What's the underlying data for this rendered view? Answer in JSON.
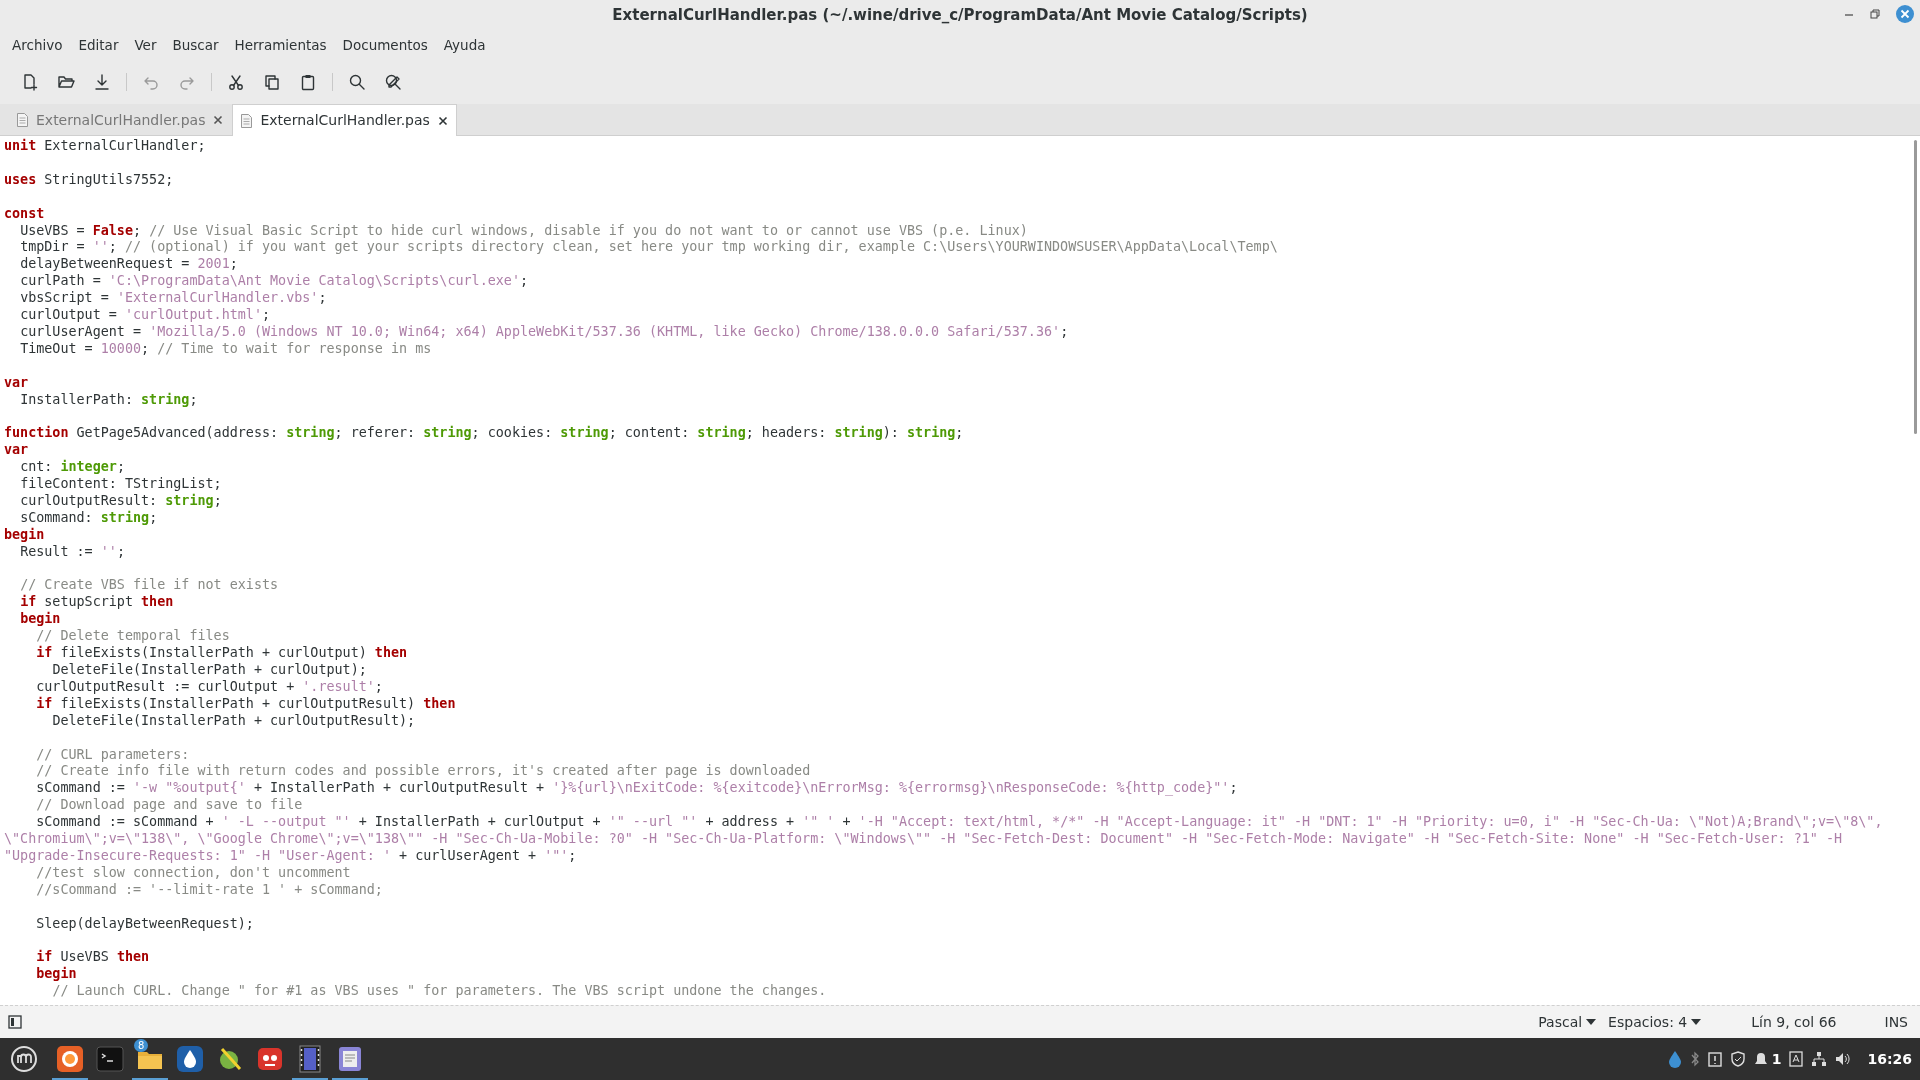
{
  "window": {
    "title": "ExternalCurlHandler.pas (~/.wine/drive_c/ProgramData/Ant Movie Catalog/Scripts)"
  },
  "menu": [
    "Archivo",
    "Editar",
    "Ver",
    "Buscar",
    "Herramientas",
    "Documentos",
    "Ayuda"
  ],
  "toolbar": [
    {
      "disabled": false
    },
    {
      "disabled": false
    },
    {
      "disabled": false
    },
    {
      "disabled": true
    },
    {
      "disabled": true
    },
    {
      "disabled": false
    },
    {
      "disabled": false
    },
    {
      "disabled": false
    },
    {
      "disabled": false
    },
    {
      "disabled": false
    }
  ],
  "tabs": [
    {
      "label": "ExternalCurlHandler.pas",
      "selected": false
    },
    {
      "label": "ExternalCurlHandler.pas",
      "selected": true
    }
  ],
  "editor": {
    "lines": [
      {
        "kind": "code",
        "tokens": [
          {
            "kind": "keyword",
            "text": "unit"
          },
          {
            "kind": "plain",
            "text": " ExternalCurlHandler;"
          }
        ]
      },
      {
        "kind": "blank"
      },
      {
        "kind": "code",
        "tokens": [
          {
            "kind": "keyword",
            "text": "uses"
          },
          {
            "kind": "plain",
            "text": " StringUtils7552;"
          }
        ]
      },
      {
        "kind": "blank"
      },
      {
        "kind": "code",
        "tokens": [
          {
            "kind": "keyword",
            "text": "const"
          }
        ]
      },
      {
        "kind": "code",
        "tokens": [
          {
            "kind": "plain",
            "text": "  UseVBS = "
          },
          {
            "kind": "keyword",
            "text": "False"
          },
          {
            "kind": "plain",
            "text": "; "
          },
          {
            "kind": "comment",
            "text": "// Use Visual Basic Script to hide curl windows, disable if you do not want to or cannot use VBS (p.e. Linux)"
          }
        ]
      },
      {
        "kind": "code",
        "tokens": [
          {
            "kind": "plain",
            "text": "  tmpDir = "
          },
          {
            "kind": "string",
            "text": "''"
          },
          {
            "kind": "plain",
            "text": "; "
          },
          {
            "kind": "comment",
            "text": "// (optional) if you want get your scripts directory clean, set here your tmp working dir, example C:\\Users\\YOURWINDOWSUSER\\AppData\\Local\\Temp\\"
          }
        ]
      },
      {
        "kind": "code",
        "tokens": [
          {
            "kind": "plain",
            "text": "  delayBetweenRequest = "
          },
          {
            "kind": "number",
            "text": "2001"
          },
          {
            "kind": "plain",
            "text": ";"
          }
        ]
      },
      {
        "kind": "code",
        "tokens": [
          {
            "kind": "plain",
            "text": "  curlPath = "
          },
          {
            "kind": "string",
            "text": "'C:\\ProgramData\\Ant Movie Catalog\\Scripts\\curl.exe'"
          },
          {
            "kind": "plain",
            "text": ";"
          }
        ]
      },
      {
        "kind": "code",
        "tokens": [
          {
            "kind": "plain",
            "text": "  vbsScript = "
          },
          {
            "kind": "string",
            "text": "'ExternalCurlHandler.vbs'"
          },
          {
            "kind": "plain",
            "text": ";"
          }
        ]
      },
      {
        "kind": "code",
        "tokens": [
          {
            "kind": "plain",
            "text": "  curlOutput = "
          },
          {
            "kind": "string",
            "text": "'curlOutput.html'"
          },
          {
            "kind": "plain",
            "text": ";"
          }
        ]
      },
      {
        "kind": "code",
        "tokens": [
          {
            "kind": "plain",
            "text": "  curlUserAgent = "
          },
          {
            "kind": "string",
            "text": "'Mozilla/5.0 (Windows NT 10.0; Win64; x64) AppleWebKit/537.36 (KHTML, like Gecko) Chrome/138.0.0.0 Safari/537.36'"
          },
          {
            "kind": "plain",
            "text": ";"
          }
        ]
      },
      {
        "kind": "code",
        "tokens": [
          {
            "kind": "plain",
            "text": "  TimeOut = "
          },
          {
            "kind": "number",
            "text": "10000"
          },
          {
            "kind": "plain",
            "text": "; "
          },
          {
            "kind": "comment",
            "text": "// Time to wait for response in ms"
          }
        ]
      },
      {
        "kind": "blank"
      },
      {
        "kind": "code",
        "tokens": [
          {
            "kind": "keyword",
            "text": "var"
          }
        ]
      },
      {
        "kind": "code",
        "tokens": [
          {
            "kind": "plain",
            "text": "  InstallerPath: "
          },
          {
            "kind": "type",
            "text": "string"
          },
          {
            "kind": "plain",
            "text": ";"
          }
        ]
      },
      {
        "kind": "blank"
      },
      {
        "kind": "code",
        "tokens": [
          {
            "kind": "keyword",
            "text": "function"
          },
          {
            "kind": "plain",
            "text": " GetPage5Advanced(address: "
          },
          {
            "kind": "type",
            "text": "string"
          },
          {
            "kind": "plain",
            "text": "; referer: "
          },
          {
            "kind": "type",
            "text": "string"
          },
          {
            "kind": "plain",
            "text": "; cookies: "
          },
          {
            "kind": "type",
            "text": "string"
          },
          {
            "kind": "plain",
            "text": "; content: "
          },
          {
            "kind": "type",
            "text": "string"
          },
          {
            "kind": "plain",
            "text": "; headers: "
          },
          {
            "kind": "type",
            "text": "string"
          },
          {
            "kind": "plain",
            "text": "): "
          },
          {
            "kind": "type",
            "text": "string"
          },
          {
            "kind": "plain",
            "text": ";"
          }
        ]
      },
      {
        "kind": "code",
        "tokens": [
          {
            "kind": "keyword",
            "text": "var"
          }
        ]
      },
      {
        "kind": "code",
        "tokens": [
          {
            "kind": "plain",
            "text": "  cnt: "
          },
          {
            "kind": "type",
            "text": "integer"
          },
          {
            "kind": "plain",
            "text": ";"
          }
        ]
      },
      {
        "kind": "code",
        "tokens": [
          {
            "kind": "plain",
            "text": "  fileContent: TStringList;"
          }
        ]
      },
      {
        "kind": "code",
        "tokens": [
          {
            "kind": "plain",
            "text": "  curlOutputResult: "
          },
          {
            "kind": "type",
            "text": "string"
          },
          {
            "kind": "plain",
            "text": ";"
          }
        ]
      },
      {
        "kind": "code",
        "tokens": [
          {
            "kind": "plain",
            "text": "  sCommand: "
          },
          {
            "kind": "type",
            "text": "string"
          },
          {
            "kind": "plain",
            "text": ";"
          }
        ]
      },
      {
        "kind": "code",
        "tokens": [
          {
            "kind": "keyword",
            "text": "begin"
          }
        ]
      },
      {
        "kind": "code",
        "tokens": [
          {
            "kind": "plain",
            "text": "  Result := "
          },
          {
            "kind": "string",
            "text": "''"
          },
          {
            "kind": "plain",
            "text": ";"
          }
        ]
      },
      {
        "kind": "blank"
      },
      {
        "kind": "code",
        "tokens": [
          {
            "kind": "comment",
            "text": "  // Create VBS file if not exists"
          }
        ]
      },
      {
        "kind": "code",
        "tokens": [
          {
            "kind": "keyword",
            "text": "  if"
          },
          {
            "kind": "plain",
            "text": " setupScript "
          },
          {
            "kind": "keyword",
            "text": "then"
          }
        ]
      },
      {
        "kind": "code",
        "tokens": [
          {
            "kind": "keyword",
            "text": "  begin"
          }
        ]
      },
      {
        "kind": "code",
        "tokens": [
          {
            "kind": "comment",
            "text": "    // Delete temporal files"
          }
        ]
      },
      {
        "kind": "code",
        "tokens": [
          {
            "kind": "keyword",
            "text": "    if"
          },
          {
            "kind": "plain",
            "text": " fileExists(InstallerPath + curlOutput) "
          },
          {
            "kind": "keyword",
            "text": "then"
          }
        ]
      },
      {
        "kind": "code",
        "tokens": [
          {
            "kind": "plain",
            "text": "      DeleteFile(InstallerPath + curlOutput);"
          }
        ]
      },
      {
        "kind": "code",
        "tokens": [
          {
            "kind": "plain",
            "text": "    curlOutputResult := curlOutput + "
          },
          {
            "kind": "string",
            "text": "'.result'"
          },
          {
            "kind": "plain",
            "text": ";"
          }
        ]
      },
      {
        "kind": "code",
        "tokens": [
          {
            "kind": "keyword",
            "text": "    if"
          },
          {
            "kind": "plain",
            "text": " fileExists(InstallerPath + curlOutputResult) "
          },
          {
            "kind": "keyword",
            "text": "then"
          }
        ]
      },
      {
        "kind": "code",
        "tokens": [
          {
            "kind": "plain",
            "text": "      DeleteFile(InstallerPath + curlOutputResult);"
          }
        ]
      },
      {
        "kind": "blank"
      },
      {
        "kind": "code",
        "tokens": [
          {
            "kind": "comment",
            "text": "    // CURL parameters:"
          }
        ]
      },
      {
        "kind": "code",
        "tokens": [
          {
            "kind": "comment",
            "text": "    // Create info file with return codes and possible errors, it's created after page is downloaded"
          }
        ]
      },
      {
        "kind": "code",
        "tokens": [
          {
            "kind": "plain",
            "text": "    sCommand := "
          },
          {
            "kind": "string",
            "text": "'-w \"%output{'"
          },
          {
            "kind": "plain",
            "text": " + InstallerPath + curlOutputResult + "
          },
          {
            "kind": "string",
            "text": "'}%{url}\\nExitCode: %{exitcode}\\nErrorMsg: %{errormsg}\\nResponseCode: %{http_code}\"'"
          },
          {
            "kind": "plain",
            "text": ";"
          }
        ]
      },
      {
        "kind": "code",
        "tokens": [
          {
            "kind": "comment",
            "text": "    // Download page and save to file"
          }
        ]
      },
      {
        "kind": "code",
        "tokens": [
          {
            "kind": "plain",
            "text": "    sCommand := sCommand + "
          },
          {
            "kind": "string",
            "text": "' -L --output \"'"
          },
          {
            "kind": "plain",
            "text": " + InstallerPath + curlOutput + "
          },
          {
            "kind": "string",
            "text": "'\" --url \"'"
          },
          {
            "kind": "plain",
            "text": " + address + "
          },
          {
            "kind": "string",
            "text": "'\" '"
          },
          {
            "kind": "plain",
            "text": " + "
          },
          {
            "kind": "string",
            "text": "'-H \"Accept: text/html, */*\" -H \"Accept-Language: it\" -H \"DNT: 1\" -H \"Priority: u=0, i\" -H \"Sec-Ch-Ua: \\\"Not)A;Brand\\\";v=\\\"8\\\", \\\"Chromium\\\";v=\\\"138\\\", \\\"Google Chrome\\\";v=\\\"138\\\"\" -H \"Sec-Ch-Ua-Mobile: ?0\" -H \"Sec-Ch-Ua-Platform: \\\"Windows\\\"\" -H \"Sec-Fetch-Dest: Document\" -H \"Sec-Fetch-Mode: Navigate\" -H \"Sec-Fetch-Site: None\" -H \"Sec-Fetch-User: ?1\" -H \"Upgrade-Insecure-Requests: 1\" -H \"User-Agent: '"
          },
          {
            "kind": "plain",
            "text": " + curlUserAgent + "
          },
          {
            "kind": "string",
            "text": "'\"'"
          },
          {
            "kind": "plain",
            "text": ";"
          }
        ]
      },
      {
        "kind": "code",
        "tokens": [
          {
            "kind": "comment",
            "text": "    //test slow connection, don't uncomment"
          }
        ]
      },
      {
        "kind": "code",
        "tokens": [
          {
            "kind": "comment",
            "text": "    //sCommand := '--limit-rate 1 ' + sCommand;"
          }
        ]
      },
      {
        "kind": "blank"
      },
      {
        "kind": "code",
        "tokens": [
          {
            "kind": "plain",
            "text": "    Sleep(delayBetweenRequest);"
          }
        ]
      },
      {
        "kind": "blank"
      },
      {
        "kind": "code",
        "tokens": [
          {
            "kind": "keyword",
            "text": "    if"
          },
          {
            "kind": "plain",
            "text": " UseVBS "
          },
          {
            "kind": "keyword",
            "text": "then"
          }
        ]
      },
      {
        "kind": "code",
        "tokens": [
          {
            "kind": "keyword",
            "text": "    begin"
          }
        ]
      },
      {
        "kind": "code",
        "tokens": [
          {
            "kind": "comment",
            "text": "      // Launch CURL. Change \" for #1 as VBS uses \" for parameters. The VBS script undone the changes."
          }
        ]
      }
    ]
  },
  "status_bar": {
    "language": "Pascal",
    "indent": "Espacios: 4",
    "position": "Lín 9, col 66",
    "mode": "INS"
  },
  "taskbar": {
    "apps": [
      {
        "running": true
      },
      {
        "running": false
      },
      {
        "running": true,
        "badge": "8"
      },
      {
        "running": false
      },
      {
        "running": false
      },
      {
        "running": false
      },
      {
        "running": true
      },
      {
        "running": true
      }
    ],
    "notification_count": "1",
    "clock": "16:26"
  }
}
